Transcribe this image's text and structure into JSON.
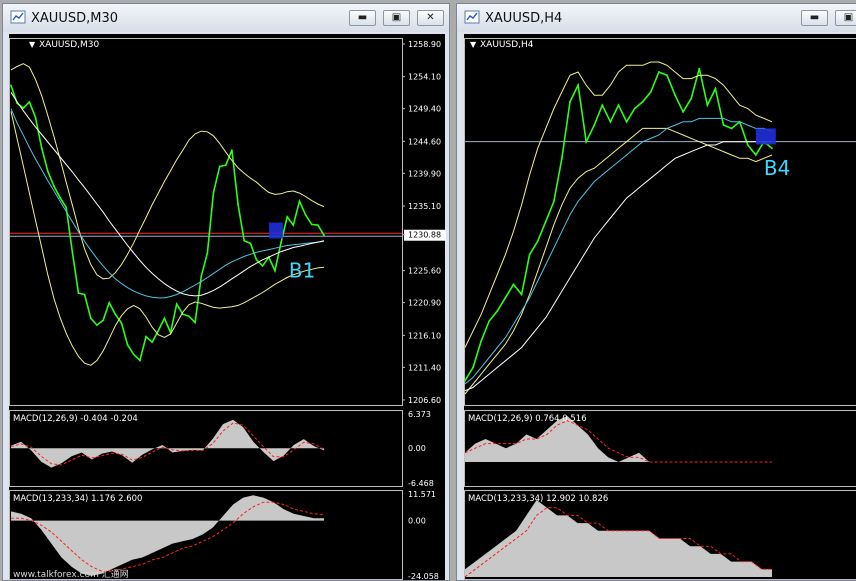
{
  "windows": [
    {
      "id": "left",
      "title": "XAUUSD,M30",
      "chart_title": "XAUUSD,M30",
      "symbol_tag": "B1",
      "main_axis_labels": [
        "1258.90",
        "1254.10",
        "1249.40",
        "1244.60",
        "1239.90",
        "1235.10",
        "1230.88",
        "1225.60",
        "1220.90",
        "1216.10",
        "1211.40",
        "1206.60"
      ],
      "current_price_label": "1230.88",
      "macd1": {
        "label": "MACD(12,26,9) -0.404 -0.204",
        "axis": [
          "6.373",
          "0.00",
          "-6.468"
        ]
      },
      "macd2": {
        "label": "MACD(13,233,34) 1.176 2.600",
        "axis": [
          "11.571",
          "0.00",
          "-24.058"
        ]
      },
      "watermark": "www.talkforex.com 汇通网"
    },
    {
      "id": "right",
      "title": "XAUUSD,H4",
      "chart_title": "XAUUSD,H4",
      "symbol_tag": "B4",
      "macd1": {
        "label": "MACD(12,26,9) 0.764 0.516"
      },
      "macd2": {
        "label": "MACD(13,233,34) 12.902 10.826"
      }
    }
  ],
  "chart_data": [
    {
      "type": "line",
      "title": "XAUUSD,M30",
      "ylim": [
        1206.6,
        1258.9
      ],
      "x": [
        0,
        6,
        12,
        18,
        24,
        30,
        36,
        42,
        48,
        54,
        60,
        66,
        72,
        78,
        84,
        90,
        96,
        102,
        108,
        114,
        120,
        126,
        132,
        138,
        144,
        150,
        156,
        162,
        168,
        174,
        180,
        186,
        192,
        198,
        204,
        210,
        216,
        222,
        228,
        234,
        240,
        246,
        252,
        258,
        264,
        270,
        276,
        282,
        288,
        294,
        300,
        306
      ],
      "series": [
        {
          "role": "price",
          "color": "#2bff17",
          "values": [
            1252.8,
            1250.2,
            1249.5,
            1250.4,
            1248.1,
            1243.6,
            1240.2,
            1238.0,
            1236.3,
            1234.9,
            1228.3,
            1222.3,
            1222.1,
            1218.6,
            1217.6,
            1218.3,
            1220.9,
            1219.2,
            1217.9,
            1214.7,
            1213.3,
            1212.4,
            1215.9,
            1215.1,
            1216.8,
            1218.6,
            1216.5,
            1220.7,
            1219.2,
            1218.9,
            1218.0,
            1224.8,
            1228.2,
            1237.1,
            1240.9,
            1241.1,
            1243.3,
            1235.3,
            1230.0,
            1229.6,
            1227.2,
            1226.3,
            1227.6,
            1225.6,
            1229.7,
            1233.5,
            1232.3,
            1235.8,
            1233.8,
            1232.4,
            1232.3,
            1230.8
          ]
        },
        {
          "role": "band",
          "color": "#f3f08a",
          "values": [
            1255.1,
            1255.6,
            1256.0,
            1255.5,
            1253.7,
            1251.3,
            1248.4,
            1245.3,
            1242.0,
            1238.6,
            1235.2,
            1231.8,
            1228.8,
            1226.5,
            1225.0,
            1224.4,
            1224.5,
            1225.3,
            1226.5,
            1228.0,
            1229.7,
            1231.6,
            1233.4,
            1235.3,
            1237.0,
            1238.7,
            1240.3,
            1241.9,
            1243.3,
            1244.8,
            1245.7,
            1246.1,
            1246.0,
            1245.4,
            1244.3,
            1243.0,
            1241.8,
            1240.7,
            1239.9,
            1239.2,
            1238.6,
            1237.8,
            1237.1,
            1236.8,
            1236.9,
            1237.2,
            1237.3,
            1237.0,
            1236.5,
            1235.9,
            1235.4,
            1235.0
          ]
        },
        {
          "role": "band",
          "color": "#f3f08a",
          "values": [
            1249.0,
            1245.0,
            1241.0,
            1237.0,
            1233.0,
            1229.0,
            1225.0,
            1221.5,
            1218.7,
            1216.4,
            1214.5,
            1213.0,
            1212.0,
            1211.7,
            1212.4,
            1213.8,
            1215.6,
            1217.5,
            1219.0,
            1220.0,
            1220.5,
            1220.0,
            1218.8,
            1217.3,
            1216.2,
            1215.8,
            1216.3,
            1217.9,
            1219.5,
            1220.6,
            1221.0,
            1220.8,
            1220.5,
            1220.2,
            1220.1,
            1220.2,
            1220.3,
            1220.5,
            1220.9,
            1221.4,
            1221.9,
            1222.4,
            1223.0,
            1223.6,
            1224.1,
            1224.6,
            1225.0,
            1225.3,
            1225.6,
            1225.8,
            1226.0,
            1226.1
          ]
        },
        {
          "role": "ma",
          "color": "#4fc3e8",
          "values": [
            1249.4,
            1247.3,
            1245.5,
            1243.7,
            1242.0,
            1240.4,
            1238.8,
            1237.3,
            1235.8,
            1234.3,
            1232.8,
            1231.3,
            1229.9,
            1228.6,
            1227.4,
            1226.3,
            1225.3,
            1224.4,
            1223.7,
            1223.1,
            1222.6,
            1222.2,
            1221.9,
            1221.7,
            1221.6,
            1221.6,
            1221.8,
            1222.1,
            1222.5,
            1223.0,
            1223.5,
            1224.0,
            1224.6,
            1225.2,
            1225.8,
            1226.4,
            1226.9,
            1227.3,
            1227.7,
            1228.0,
            1228.3,
            1228.5,
            1228.7,
            1228.9,
            1229.1,
            1229.3,
            1229.4,
            1229.5,
            1229.6,
            1229.7,
            1229.8,
            1229.9
          ]
        },
        {
          "role": "ma",
          "color": "#ffffff",
          "values": [
            1251.8,
            1250.4,
            1249.1,
            1247.9,
            1246.7,
            1245.6,
            1244.5,
            1243.4,
            1242.3,
            1241.2,
            1240.1,
            1238.9,
            1237.8,
            1236.6,
            1235.4,
            1234.2,
            1232.9,
            1231.7,
            1230.5,
            1229.3,
            1228.2,
            1227.1,
            1226.1,
            1225.2,
            1224.4,
            1223.7,
            1223.1,
            1222.6,
            1222.2,
            1222.0,
            1221.9,
            1222.0,
            1222.3,
            1222.7,
            1223.2,
            1223.8,
            1224.4,
            1225.0,
            1225.6,
            1226.2,
            1226.7,
            1227.2,
            1227.6,
            1228.0,
            1228.4,
            1228.7,
            1229.0,
            1229.2,
            1229.4,
            1229.6,
            1229.8,
            1230.0
          ]
        }
      ],
      "hlines": [
        {
          "y": 1230.88,
          "color": "#ff2a2a"
        }
      ]
    },
    {
      "type": "area",
      "title": "MACD(12,26,9) -0.404 -0.204",
      "ylim": [
        -6.468,
        6.373
      ],
      "x": [
        0,
        10,
        20,
        30,
        40,
        50,
        60,
        70,
        80,
        90,
        100,
        110,
        120,
        130,
        140,
        150,
        160,
        170,
        180,
        190,
        200,
        210,
        220,
        230,
        240,
        250,
        260,
        270,
        280,
        290,
        300,
        310
      ],
      "series": [
        {
          "role": "histogram",
          "color": "#c8c8c8",
          "values": [
            0.5,
            1.2,
            -0.4,
            -2.5,
            -3.6,
            -2.8,
            -1.5,
            -0.8,
            -2.1,
            -1.0,
            -0.6,
            -1.3,
            -2.7,
            -1.2,
            -0.2,
            0.6,
            -0.8,
            -0.5,
            -0.3,
            -0.4,
            1.8,
            4.5,
            5.3,
            3.9,
            1.2,
            -0.7,
            -2.4,
            -1.4,
            0.6,
            1.7,
            0.4,
            -0.4
          ]
        },
        {
          "role": "signal",
          "color": "#ff2020",
          "values": [
            0.3,
            0.8,
            0.2,
            -1.5,
            -2.9,
            -3.1,
            -2.2,
            -1.3,
            -1.8,
            -1.4,
            -0.9,
            -1.1,
            -2.2,
            -1.7,
            -0.7,
            0.2,
            -0.3,
            -0.5,
            -0.4,
            -0.4,
            0.9,
            3.2,
            4.7,
            4.3,
            2.3,
            0.3,
            -1.6,
            -1.6,
            -0.3,
            1.1,
            0.8,
            -0.2
          ]
        }
      ]
    },
    {
      "type": "area",
      "title": "MACD(13,233,34) 1.176 2.600",
      "ylim": [
        -24.058,
        11.571
      ],
      "x": [
        0,
        10,
        20,
        30,
        40,
        50,
        60,
        70,
        80,
        90,
        100,
        110,
        120,
        130,
        140,
        150,
        160,
        170,
        180,
        190,
        200,
        210,
        220,
        230,
        240,
        250,
        260,
        270,
        280,
        290,
        300,
        310
      ],
      "series": [
        {
          "role": "histogram",
          "color": "#c8c8c8",
          "values": [
            4,
            3,
            1,
            -4,
            -10,
            -16,
            -20,
            -23,
            -24,
            -23,
            -21,
            -19,
            -17,
            -16,
            -14,
            -12,
            -10,
            -9,
            -8,
            -6,
            -3,
            2,
            7,
            10,
            11,
            10,
            8,
            5,
            3,
            2,
            1,
            1
          ]
        },
        {
          "role": "signal",
          "color": "#ff2020",
          "values": [
            1,
            1,
            0,
            -2,
            -5,
            -9,
            -13,
            -17,
            -20,
            -22,
            -22,
            -21,
            -20,
            -19,
            -17,
            -16,
            -14,
            -12,
            -11,
            -9,
            -7,
            -4,
            -1,
            3,
            6,
            8,
            8,
            7,
            5,
            4,
            3,
            2.6
          ]
        }
      ]
    },
    {
      "type": "line",
      "title": "XAUUSD,H4",
      "x": [
        0,
        8,
        16,
        24,
        32,
        40,
        48,
        56,
        64,
        72,
        80,
        88,
        96,
        104,
        112,
        120,
        128,
        136,
        144,
        152,
        160,
        168,
        176,
        184,
        192,
        200,
        208,
        216,
        224,
        232,
        240,
        248,
        256,
        264,
        272,
        280,
        288,
        296,
        304
      ],
      "series": [
        {
          "role": "price",
          "color": "#2bff17",
          "values": [
            0.04,
            0.08,
            0.16,
            0.22,
            0.25,
            0.29,
            0.33,
            0.3,
            0.42,
            0.46,
            0.52,
            0.58,
            0.71,
            0.88,
            0.93,
            0.76,
            0.81,
            0.87,
            0.82,
            0.87,
            0.82,
            0.86,
            0.88,
            0.91,
            0.97,
            0.96,
            0.9,
            0.85,
            0.89,
            0.98,
            0.87,
            0.92,
            0.81,
            0.8,
            0.82,
            0.75,
            0.72,
            0.76,
            0.74
          ]
        },
        {
          "role": "band",
          "color": "#f3f08a",
          "values": [
            0.14,
            0.19,
            0.24,
            0.3,
            0.36,
            0.42,
            0.49,
            0.57,
            0.66,
            0.74,
            0.8,
            0.86,
            0.91,
            0.96,
            0.97,
            0.93,
            0.9,
            0.9,
            0.93,
            0.97,
            0.99,
            0.99,
            0.99,
            1.0,
            1.0,
            0.99,
            0.97,
            0.95,
            0.95,
            0.96,
            0.96,
            0.95,
            0.93,
            0.9,
            0.87,
            0.86,
            0.84,
            0.83,
            0.82
          ]
        },
        {
          "role": "band",
          "color": "#f3f08a",
          "values": [
            0.0,
            0.03,
            0.06,
            0.09,
            0.12,
            0.15,
            0.19,
            0.24,
            0.3,
            0.37,
            0.44,
            0.51,
            0.57,
            0.62,
            0.65,
            0.67,
            0.68,
            0.7,
            0.72,
            0.74,
            0.76,
            0.78,
            0.8,
            0.8,
            0.8,
            0.8,
            0.79,
            0.78,
            0.77,
            0.76,
            0.75,
            0.74,
            0.73,
            0.72,
            0.71,
            0.71,
            0.7,
            0.71,
            0.72
          ]
        },
        {
          "role": "ma",
          "color": "#4fc3e8",
          "values": [
            0.03,
            0.05,
            0.08,
            0.11,
            0.14,
            0.17,
            0.21,
            0.25,
            0.29,
            0.34,
            0.39,
            0.44,
            0.49,
            0.54,
            0.58,
            0.61,
            0.64,
            0.66,
            0.68,
            0.7,
            0.72,
            0.74,
            0.76,
            0.77,
            0.78,
            0.8,
            0.81,
            0.82,
            0.82,
            0.83,
            0.83,
            0.83,
            0.83,
            0.82,
            0.82,
            0.81,
            0.8,
            0.8,
            0.79
          ]
        },
        {
          "role": "ma",
          "color": "#ffffff",
          "values": [
            0.01,
            0.02,
            0.04,
            0.06,
            0.08,
            0.1,
            0.12,
            0.14,
            0.17,
            0.2,
            0.23,
            0.27,
            0.31,
            0.35,
            0.39,
            0.43,
            0.47,
            0.5,
            0.53,
            0.56,
            0.59,
            0.61,
            0.63,
            0.65,
            0.67,
            0.69,
            0.71,
            0.72,
            0.73,
            0.74,
            0.75,
            0.75,
            0.76,
            0.76,
            0.76,
            0.76,
            0.76,
            0.76,
            0.76
          ]
        }
      ]
    },
    {
      "type": "area",
      "title": "MACD(12,26,9) 0.764 0.516",
      "x": [
        0,
        10,
        20,
        30,
        40,
        50,
        60,
        70,
        80,
        90,
        100,
        110,
        120,
        130,
        140,
        150,
        160,
        170,
        180,
        190,
        200,
        210,
        220,
        230,
        240,
        250,
        260,
        270,
        280,
        290,
        300
      ],
      "series": [
        {
          "role": "histogram",
          "color": "#c8c8c8",
          "values": [
            0.2,
            0.4,
            0.5,
            0.4,
            0.3,
            0.4,
            0.6,
            0.5,
            0.7,
            0.9,
            1.0,
            0.8,
            0.6,
            0.3,
            0.1,
            0.0,
            0.1,
            0.2,
            0.0,
            0.0,
            0.0,
            0.0,
            0.0,
            0.0,
            0.0,
            0.0,
            0.0,
            0.0,
            0.0,
            0.0,
            0.0
          ]
        },
        {
          "role": "signal",
          "color": "#ff2020",
          "values": [
            0.2,
            0.3,
            0.4,
            0.4,
            0.4,
            0.4,
            0.5,
            0.5,
            0.6,
            0.8,
            0.9,
            0.8,
            0.7,
            0.5,
            0.3,
            0.2,
            0.1,
            0.1,
            0.0,
            0.0,
            0.0,
            0.0,
            0.0,
            0.0,
            0.0,
            0.0,
            0.0,
            0.0,
            0.0,
            0.0,
            0.0
          ]
        }
      ]
    },
    {
      "type": "area",
      "title": "MACD(13,233,34) 12.902 10.826",
      "x": [
        0,
        10,
        20,
        30,
        40,
        50,
        60,
        70,
        80,
        90,
        100,
        110,
        120,
        130,
        140,
        150,
        160,
        170,
        180,
        190,
        200,
        210,
        220,
        230,
        240,
        250,
        260,
        270,
        280,
        290,
        300
      ],
      "series": [
        {
          "role": "histogram",
          "color": "#c8c8c8",
          "values": [
            0.1,
            0.2,
            0.3,
            0.4,
            0.5,
            0.6,
            0.8,
            1.0,
            0.9,
            0.8,
            0.8,
            0.7,
            0.7,
            0.6,
            0.6,
            0.6,
            0.6,
            0.6,
            0.6,
            0.5,
            0.5,
            0.5,
            0.4,
            0.4,
            0.3,
            0.3,
            0.2,
            0.2,
            0.2,
            0.1,
            0.1
          ]
        },
        {
          "role": "signal",
          "color": "#ff2020",
          "values": [
            0.0,
            0.1,
            0.2,
            0.3,
            0.4,
            0.5,
            0.6,
            0.8,
            0.9,
            0.9,
            0.8,
            0.8,
            0.7,
            0.7,
            0.6,
            0.6,
            0.6,
            0.6,
            0.6,
            0.5,
            0.5,
            0.5,
            0.5,
            0.4,
            0.4,
            0.3,
            0.3,
            0.2,
            0.2,
            0.1,
            0.1
          ]
        }
      ]
    }
  ]
}
